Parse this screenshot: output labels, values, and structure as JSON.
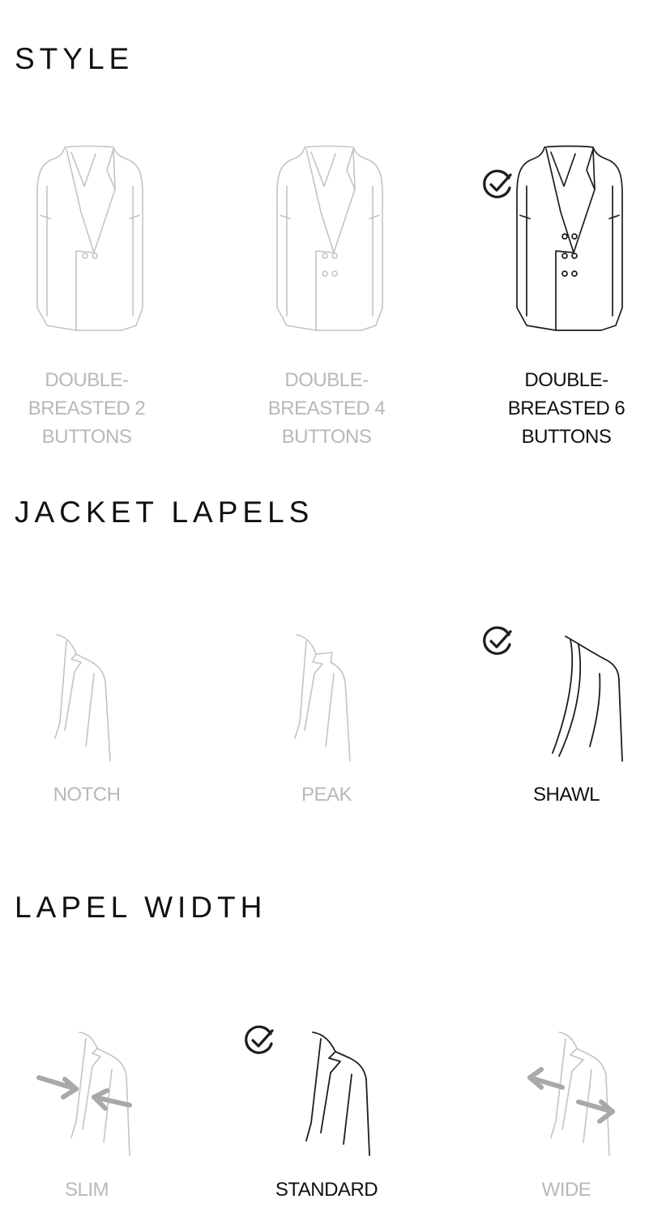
{
  "sections": {
    "style": {
      "title": "STYLE",
      "options": [
        {
          "label_l1": "DOUBLE-",
          "label_l2": "BREASTED 2",
          "label_l3": "BUTTONS",
          "selected": false,
          "icon": "double-breasted-2-jacket-icon"
        },
        {
          "label_l1": "DOUBLE-",
          "label_l2": "BREASTED 4",
          "label_l3": "BUTTONS",
          "selected": false,
          "icon": "double-breasted-4-jacket-icon"
        },
        {
          "label_l1": "DOUBLE-",
          "label_l2": "BREASTED 6",
          "label_l3": "BUTTONS",
          "selected": true,
          "icon": "double-breasted-6-jacket-icon"
        }
      ]
    },
    "lapels": {
      "title": "JACKET LAPELS",
      "options": [
        {
          "label": "NOTCH",
          "selected": false,
          "icon": "notch-lapel-icon"
        },
        {
          "label": "PEAK",
          "selected": false,
          "icon": "peak-lapel-icon"
        },
        {
          "label": "SHAWL",
          "selected": true,
          "icon": "shawl-lapel-icon"
        }
      ]
    },
    "lapel_width": {
      "title": "LAPEL WIDTH",
      "options": [
        {
          "label": "SLIM",
          "selected": false,
          "icon": "slim-lapel-icon"
        },
        {
          "label": "STANDARD",
          "selected": true,
          "icon": "standard-lapel-icon"
        },
        {
          "label": "WIDE",
          "selected": false,
          "icon": "wide-lapel-icon"
        }
      ]
    }
  },
  "colors": {
    "selected_text": "#111111",
    "unselected_text": "#b8b8b8",
    "selected_stroke": "#1d1d1d",
    "unselected_stroke": "#c4c4c4"
  }
}
